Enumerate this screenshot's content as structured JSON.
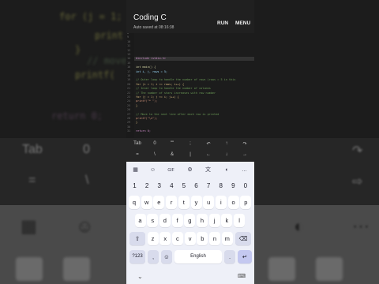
{
  "app": {
    "title": "Coding C",
    "subtitle": "Auto saved at 08:16:38",
    "run_label": "RUN",
    "menu_label": "MENU"
  },
  "background": {
    "code_lines": [
      "for (j = 1; j <= i; j++)",
      "print",
      "}",
      "// move",
      "printf(",
      "return 0;"
    ],
    "bar_symbols": [
      "Tab",
      "0"
    ],
    "bar_symbols_row2": [
      "=",
      "\\"
    ],
    "kb_icons": [
      "grid-icon",
      "sticker-icon",
      "palette-icon"
    ]
  },
  "editor": {
    "line_numbers": [
      "8",
      "9",
      "10",
      "11",
      "12",
      "13",
      "14",
      "15",
      "16",
      "17",
      "18",
      "19",
      "20",
      "21",
      "22",
      "23",
      "24",
      "25",
      "26",
      "27",
      "28",
      "29",
      "30",
      "31"
    ],
    "lines": [
      {
        "text": "",
        "color": "#8a8a5a"
      },
      {
        "text": "",
        "color": "#8a8a5a"
      },
      {
        "text": "",
        "color": "#8a8a5a"
      },
      {
        "text": "",
        "color": "#8a8a5a"
      },
      {
        "text": "",
        "color": "#8a8a5a"
      },
      {
        "text": "",
        "color": "#8a8a5a"
      },
      {
        "text": "#include <stdio.h>",
        "color": "#c586c0"
      },
      {
        "text": "",
        "color": "#8a8a5a"
      },
      {
        "text": "int main() {",
        "color": "#dcdcaa"
      },
      {
        "text": "  int i, j, rows = 5;",
        "color": "#9cdcfe"
      },
      {
        "text": "",
        "color": "#8a8a5a"
      },
      {
        "text": "  // Outer loop to handle the number of rows (rows = 5 in this",
        "color": "#6a9955"
      },
      {
        "text": "  for (i = 1; i <= rows; i++) {",
        "color": "#d7ba7d"
      },
      {
        "text": "      // Inner loop to handle the number of columns",
        "color": "#6a9955"
      },
      {
        "text": "      // The number of stars increases with row number",
        "color": "#6a9955"
      },
      {
        "text": "      for (j = 1; j <= i; j++) {",
        "color": "#d7ba7d"
      },
      {
        "text": "          printf(\"* \");",
        "color": "#ce9178"
      },
      {
        "text": "      }",
        "color": "#d7ba7d"
      },
      {
        "text": "",
        "color": "#8a8a5a"
      },
      {
        "text": "      // Move to the next line after each row is printed",
        "color": "#6a9955"
      },
      {
        "text": "      printf(\"\\n\");",
        "color": "#ce9178"
      },
      {
        "text": "  }",
        "color": "#d7ba7d"
      },
      {
        "text": "",
        "color": "#8a8a5a"
      },
      {
        "text": "  return 0;",
        "color": "#c586c0"
      }
    ]
  },
  "symbols": {
    "row1": [
      "Tab",
      "0",
      "\"\"",
      ";",
      "↶",
      "↑",
      "↷"
    ],
    "row2": [
      "=",
      "\\",
      "&",
      "|",
      "←",
      "↓",
      "→"
    ]
  },
  "keyboard": {
    "toolbar": [
      "▦",
      "☺",
      "GIF",
      "⚙",
      "文",
      "◐",
      "…"
    ],
    "numbers": [
      "1",
      "2",
      "3",
      "4",
      "5",
      "6",
      "7",
      "8",
      "9",
      "0"
    ],
    "row1": [
      "q",
      "w",
      "e",
      "r",
      "t",
      "y",
      "u",
      "i",
      "o",
      "p"
    ],
    "row2": [
      "a",
      "s",
      "d",
      "f",
      "g",
      "h",
      "j",
      "k",
      "l"
    ],
    "row3": [
      "z",
      "x",
      "c",
      "v",
      "b",
      "n",
      "m"
    ],
    "shift": "⇧",
    "backspace": "⌫",
    "sym_key": "?123",
    "comma": ",",
    "emoji": "☺",
    "space": "English",
    "period": ".",
    "enter": "↵",
    "nav_down": "⌄",
    "nav_kb": "⌨"
  }
}
